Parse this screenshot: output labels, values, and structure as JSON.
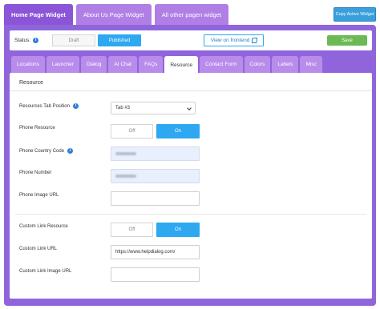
{
  "top_tabs": [
    {
      "label": "Home Page Widget",
      "active": true
    },
    {
      "label": "About Us Page Widget",
      "active": false
    },
    {
      "label": "All other pagen widget",
      "active": false
    }
  ],
  "copy_button": "Copy Active Widget",
  "status": {
    "label": "Status:",
    "draft": "Draft",
    "published": "Published",
    "view": "View on frontend",
    "save": "Save"
  },
  "section_tabs": [
    "Locations",
    "Launcher",
    "Dialog",
    "AI Chat",
    "FAQs",
    "Resource",
    "Contact Form",
    "Colors",
    "Labels",
    "Misc"
  ],
  "active_section_tab": "Resource",
  "panel": {
    "title": "Resource",
    "resources_tab_position": {
      "label": "Resources Tab Position",
      "value": "Tab #3"
    },
    "phone_resource": {
      "label": "Phone Resource",
      "off": "Off",
      "on": "On",
      "selected": "On"
    },
    "phone_country_code": {
      "label": "Phone Country Code"
    },
    "phone_number": {
      "label": "Phone Number"
    },
    "phone_image_url": {
      "label": "Phone Image URL",
      "value": ""
    },
    "custom_link_resource": {
      "label": "Custom Link Resource",
      "off": "Off",
      "on": "On",
      "selected": "On"
    },
    "custom_link_url": {
      "label": "Custom Link URL",
      "value": "https://www.helpdialog.com/"
    },
    "custom_link_image_url": {
      "label": "Custom Link Image URL",
      "value": ""
    }
  },
  "colors": {
    "frame": "#9065dc",
    "tab_inactive": "#b98ceb",
    "accent_blue": "#2ea8f0",
    "save_green": "#6cba54"
  }
}
